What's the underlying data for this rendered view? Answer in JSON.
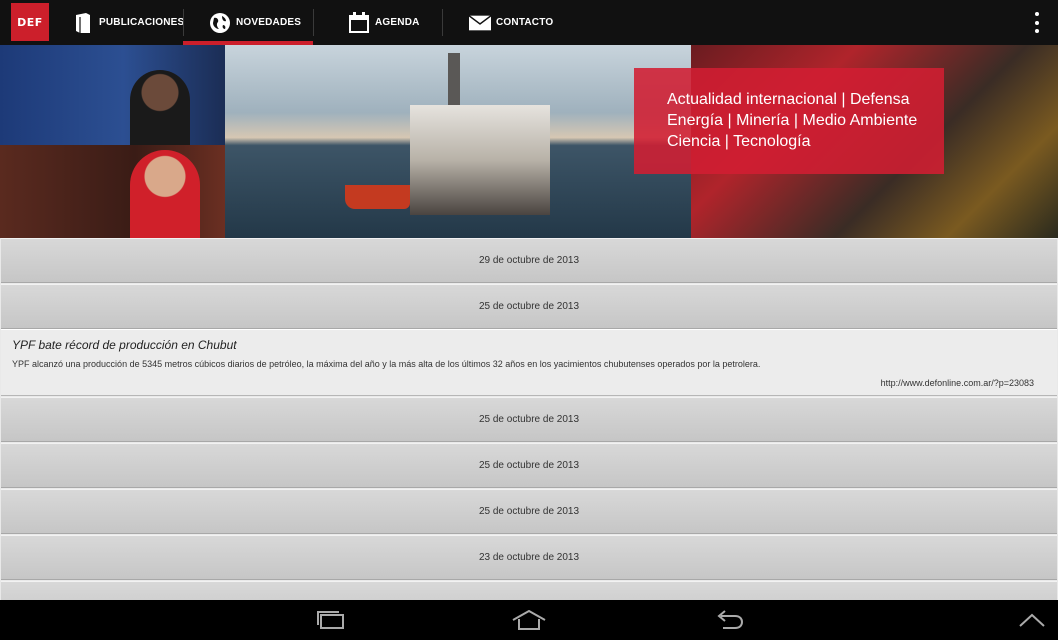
{
  "app": {
    "logo_text": "DEF",
    "colors": {
      "accent": "#cc1f2b",
      "actionbar": "#111111",
      "tagline_bg": "#d21e32"
    }
  },
  "tabs": [
    {
      "label": "PUBLICACIONES",
      "icon": "book-icon"
    },
    {
      "label": "NOVEDADES",
      "icon": "globe-icon",
      "active": true
    },
    {
      "label": "AGENDA",
      "icon": "calendar-icon"
    },
    {
      "label": "CONTACTO",
      "icon": "envelope-icon"
    }
  ],
  "banner": {
    "tagline_lines": [
      "Actualidad internacional | Defensa",
      "Energía | Minería | Medio Ambiente",
      "Ciencia | Tecnología"
    ]
  },
  "list": {
    "dates": [
      "29 de octubre de 2013",
      "25 de octubre de 2013",
      "25 de octubre de 2013",
      "25 de octubre de 2013",
      "25 de octubre de 2013",
      "23 de octubre de 2013"
    ],
    "expanded_article": {
      "title": "YPF bate récord de producción en Chubut",
      "body": "YPF alcanzó una producción de 5345 metros cúbicos diarios de petróleo, la máxima del año y la más alta de los últimos 32 años en los yacimientos chubutenses operados por la petrolera.",
      "link": "http://www.defonline.com.ar/?p=23083"
    }
  },
  "system_nav": [
    {
      "icon": "recent-apps-icon"
    },
    {
      "icon": "home-icon"
    },
    {
      "icon": "back-icon"
    },
    {
      "icon": "chevron-up-icon"
    }
  ]
}
